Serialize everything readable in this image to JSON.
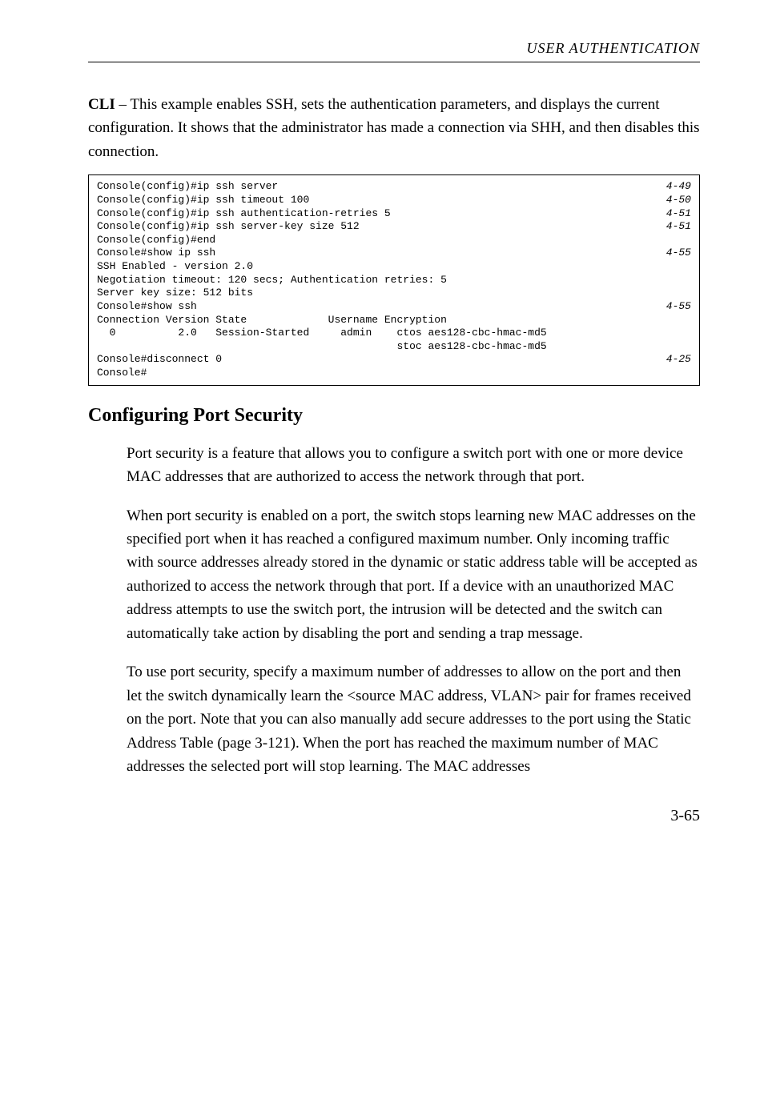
{
  "running_head": "USER AUTHENTICATION",
  "intro": {
    "cli_label": "CLI",
    "text": " – This example enables SSH, sets the authentication parameters, and displays the current configuration. It shows that the administrator has made a connection via SHH, and then disables this connection."
  },
  "code": {
    "lines": [
      {
        "text": "Console(config)#ip ssh server",
        "ref": "4-49"
      },
      {
        "text": "Console(config)#ip ssh timeout 100",
        "ref": "4-50"
      },
      {
        "text": "Console(config)#ip ssh authentication-retries 5",
        "ref": "4-51"
      },
      {
        "text": "Console(config)#ip ssh server-key size 512",
        "ref": "4-51"
      },
      {
        "text": "Console(config)#end",
        "ref": ""
      },
      {
        "text": "Console#show ip ssh",
        "ref": "4-55"
      },
      {
        "text": "SSH Enabled - version 2.0",
        "ref": ""
      },
      {
        "text": "Negotiation timeout: 120 secs; Authentication retries: 5",
        "ref": ""
      },
      {
        "text": "Server key size: 512 bits",
        "ref": ""
      },
      {
        "text": "Console#show ssh",
        "ref": "4-55"
      },
      {
        "text": "Connection Version State             Username Encryption",
        "ref": ""
      },
      {
        "text": "  0          2.0   Session-Started     admin    ctos aes128-cbc-hmac-md5",
        "ref": ""
      },
      {
        "text": "                                                stoc aes128-cbc-hmac-md5",
        "ref": ""
      },
      {
        "text": "Console#disconnect 0",
        "ref": "4-25"
      },
      {
        "text": "Console#",
        "ref": ""
      }
    ]
  },
  "section": {
    "heading": "Configuring Port Security",
    "p1": "Port security is a feature that allows you to configure a switch port with one or more device MAC addresses that are authorized to access the network through that port.",
    "p2": "When port security is enabled on a port, the switch stops learning new MAC addresses on the specified port when it has reached a configured maximum number. Only incoming traffic with source addresses already stored in the dynamic or static address table will be accepted as authorized to access the network through that port. If a device with an unauthorized MAC address attempts to use the switch port, the intrusion will be detected and the switch can automatically take action by disabling the port and sending a trap message.",
    "p3": "To use port security, specify a maximum number of addresses to allow on the port and then let the switch dynamically learn the <source MAC address, VLAN> pair for frames received on the port. Note that you can also manually add secure addresses to the port using the Static Address Table (page 3-121). When the port has reached the maximum number of MAC addresses the selected port will stop learning. The MAC addresses"
  },
  "page_number": "3-65"
}
